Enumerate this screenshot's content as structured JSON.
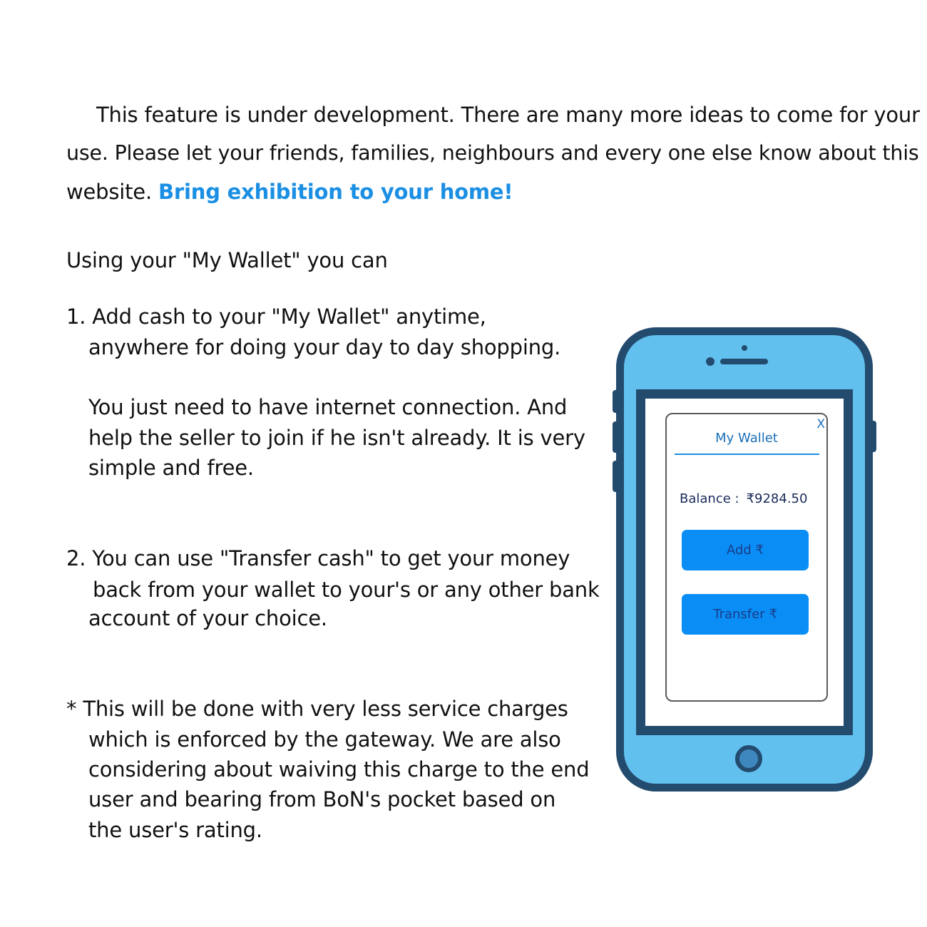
{
  "intro": {
    "line1": "This feature is under development. There are many more ideas to come for your",
    "line2": "use. Please let your friends, families, neighbours and every one else know about this",
    "line3_prefix": "website.",
    "highlight": "Bring exhibition to your home!"
  },
  "wallet_intro": "Using your \"My Wallet\" you can",
  "point1": {
    "line1": "1. Add cash to your \"My Wallet\" anytime,",
    "line2": "anywhere for doing your day to day shopping.",
    "note_line1": "You just need to have internet connection. And",
    "note_line2": "help the seller to join if he isn't already. It is very",
    "note_line3": "simple and free."
  },
  "point2": {
    "line1": "2. You can use \"Transfer cash\" to get your money",
    "line2": "back from your wallet to your's or any other bank",
    "line3": "account of your choice."
  },
  "footnote": {
    "line1": "* This will be done with very less service charges",
    "line2": "which is enforced by the gateway. We are also",
    "line3": "considering about waiving this charge to the end",
    "line4": "user and bearing from BoN's pocket based on",
    "line5": "the user's rating."
  },
  "wallet": {
    "title": "My Wallet",
    "close": "X",
    "balance_label": "Balance :",
    "balance_value": "₹9284.50",
    "add_button": "Add ₹",
    "transfer_button": "Transfer ₹"
  },
  "colors": {
    "highlight": "#1a8fe3",
    "phone_body": "#62c0ef",
    "phone_frame": "#234b6e",
    "button": "#0a8ef5"
  }
}
